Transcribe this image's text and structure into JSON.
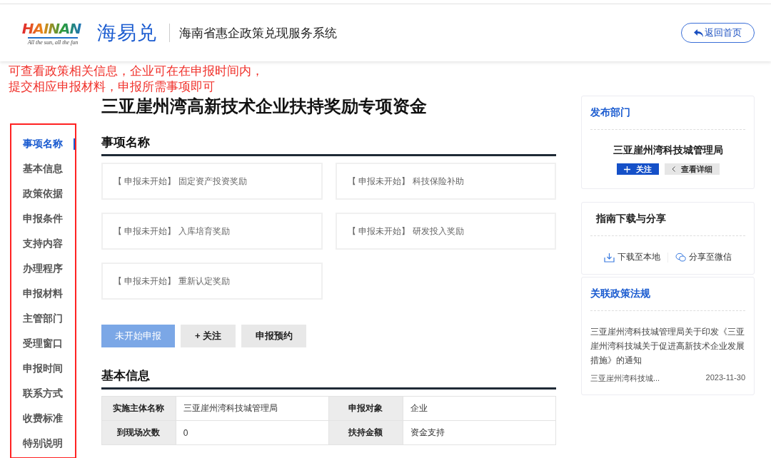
{
  "header": {
    "logo_text": "HAINAN",
    "logo_tagline": "All the sun, all the fun",
    "brand": "海易兑",
    "system_title": "海南省惠企政策兑现服务系统",
    "home_button": "返回首页"
  },
  "annotation": {
    "lines": [
      "可查看政策相关信息，企业可在在申报时间内，",
      "提交相应申报材料，申报所需事项即可"
    ]
  },
  "page_title": "三亚崖州湾高新技术企业扶持奖励专项资金",
  "sidebar": {
    "items": [
      {
        "label": "事项名称",
        "selected": true
      },
      {
        "label": "基本信息",
        "selected": false
      },
      {
        "label": "政策依据",
        "selected": false
      },
      {
        "label": "申报条件",
        "selected": false
      },
      {
        "label": "支持内容",
        "selected": false
      },
      {
        "label": "办理程序",
        "selected": false
      },
      {
        "label": "申报材料",
        "selected": false
      },
      {
        "label": "主管部门",
        "selected": false
      },
      {
        "label": "受理窗口",
        "selected": false
      },
      {
        "label": "申报时间",
        "selected": false
      },
      {
        "label": "联系方式",
        "selected": false
      },
      {
        "label": "收费标准",
        "selected": false
      },
      {
        "label": "特别说明",
        "selected": false
      }
    ]
  },
  "items_section": {
    "title": "事项名称",
    "items": [
      "【 申报未开始】 固定资产投资奖励",
      "【 申报未开始】 科技保险补助",
      "【 申报未开始】 入库培育奖励",
      "【 申报未开始】 研发投入奖励",
      "【 申报未开始】 重新认定奖励"
    ]
  },
  "actions": [
    {
      "label": "未开始申报",
      "kind": "primary"
    },
    {
      "label": "+ 关注",
      "kind": "plain"
    },
    {
      "label": "申报预约",
      "kind": "plain"
    }
  ],
  "basic_info": {
    "title": "基本信息",
    "rows": [
      [
        {
          "label": "实施主体名称",
          "value": "三亚崖州湾科技城管理局"
        },
        {
          "label": "申报对象",
          "value": "企业"
        }
      ],
      [
        {
          "label": "到现场次数",
          "value": "0"
        },
        {
          "label": "扶持金额",
          "value": "资金支持"
        }
      ]
    ]
  },
  "publisher": {
    "title": "发布部门",
    "name": "三亚崖州湾科技城管理局",
    "follow": "关注",
    "details": "查看详细"
  },
  "downloads": {
    "title": "指南下载与分享",
    "actions": [
      {
        "label": "下载至本地",
        "kind": "download"
      },
      {
        "label": "分享至微信",
        "kind": "wechat"
      }
    ]
  },
  "related": {
    "title": "关联政策法规",
    "items": [
      {
        "title": "三亚崖州湾科技城管理局关于印发《三亚崖州湾科技城关于促进高新技术企业发展措施》的通知",
        "source": "三亚崖州湾科技城...",
        "date": "2023-11-30"
      }
    ]
  }
}
